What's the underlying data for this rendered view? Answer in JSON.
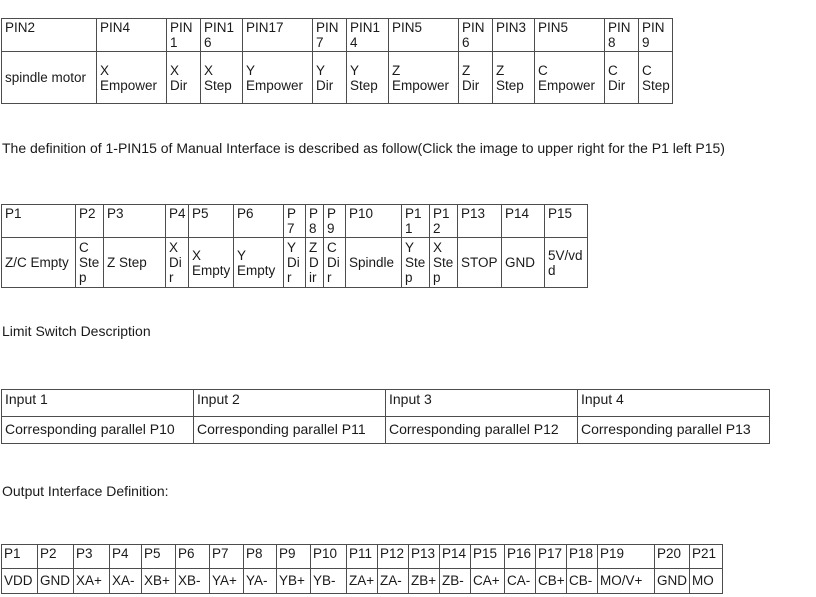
{
  "document": {
    "background_color": "#ffffff",
    "text_color": "#1a1a1a",
    "border_color": "#4d4d4d"
  },
  "paragraphs": {
    "manual_interface_note": "The definition of 1-PIN15 of Manual Interface is described as follow(Click the image to upper right for the P1 left P15)",
    "limit_switch_heading": "Limit Switch Description",
    "output_interface_heading": "Output Interface Definition:"
  },
  "table_parallel_pins": {
    "columns": [
      95,
      70,
      34,
      42,
      70,
      34,
      42,
      70,
      34,
      42,
      70,
      34,
      34
    ],
    "header": [
      "PIN2",
      "PIN4",
      "PIN1",
      "PIN16",
      "PIN17",
      "PIN7",
      "PIN14",
      "PIN5",
      "PIN6",
      "PIN3",
      "PIN5",
      "PIN8",
      "PIN9"
    ],
    "body": [
      "spindle motor",
      "X Empower",
      "X Dir",
      "X Step",
      "Y Empower",
      "Y Dir",
      "Y Step",
      "Z Empower",
      "Z Dir",
      "Z Step",
      "C Empower",
      "C Dir",
      "C Step"
    ]
  },
  "table_manual_interface": {
    "columns": [
      74,
      28,
      62,
      23,
      45,
      50,
      22,
      18,
      22,
      56,
      28,
      28,
      44,
      43,
      43
    ],
    "header": [
      "P1",
      "P2",
      "P3",
      "P4",
      "P5",
      "P6",
      "P7",
      "P8",
      "P9",
      "P10",
      "P11",
      "P12",
      "P13",
      "P14",
      "P15"
    ],
    "body": [
      "Z/C Empty",
      "C Step",
      "Z Step",
      "X Dir",
      "X Empty",
      "Y Empty",
      "Y Dir",
      "Z Dir",
      "C Dir",
      "Spindle",
      "Y Step",
      "X Step",
      "STOP",
      "GND",
      "5V/vdd"
    ]
  },
  "table_limit_switch": {
    "columns": [
      192,
      192,
      192,
      192
    ],
    "header": [
      "Input 1",
      "Input 2",
      "Input 3",
      "Input 4"
    ],
    "body": [
      "Corresponding parallel P10",
      "Corresponding parallel P11",
      "Corresponding parallel P12",
      "Corresponding parallel P13"
    ]
  },
  "table_output_interface": {
    "columns": [
      36,
      36,
      36,
      32,
      34,
      34,
      34,
      33,
      34,
      36,
      31,
      31,
      31,
      31,
      34,
      31,
      31,
      31,
      57,
      35,
      33
    ],
    "header": [
      "P1",
      "P2",
      "P3",
      "P4",
      "P5",
      "P6",
      "P7",
      "P8",
      "P9",
      "P10",
      "P11",
      "P12",
      "P13",
      "P14",
      "P15",
      "P16",
      "P17",
      "P18",
      "P19",
      "P20",
      "P21"
    ],
    "body": [
      "VDD",
      "GND",
      "XA+",
      "XA-",
      "XB+",
      "XB-",
      "YA+",
      "YA-",
      "YB+",
      "YB-",
      "ZA+",
      "ZA-",
      "ZB+",
      "ZB-",
      "CA+",
      "CA-",
      "CB+",
      "CB-",
      "MO/V+",
      "GND",
      "MO"
    ]
  }
}
